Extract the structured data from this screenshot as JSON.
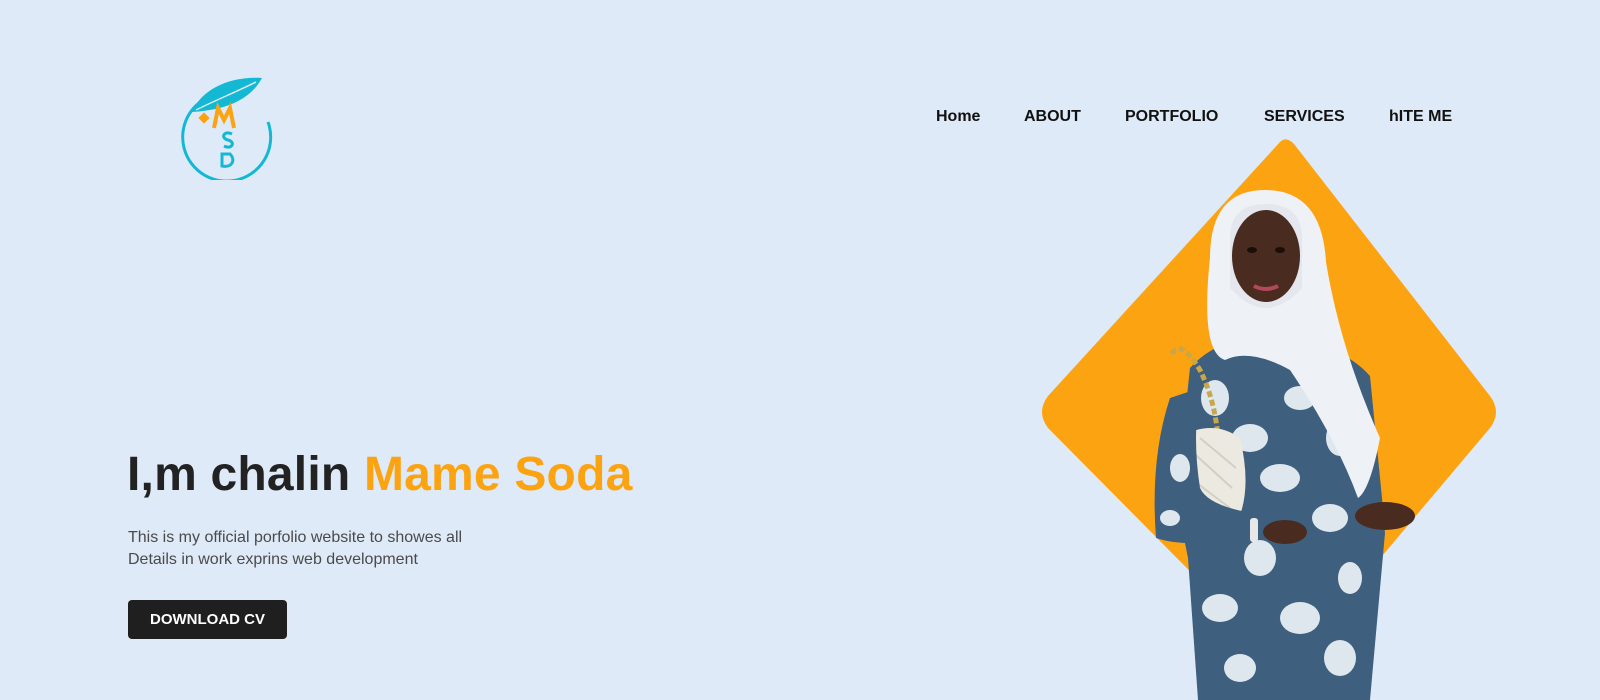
{
  "brand": {
    "logo_icon": "msd-leaf-logo-icon",
    "accent": "#fca311",
    "teal": "#13b8d3"
  },
  "nav": {
    "items": [
      {
        "label": "Home"
      },
      {
        "label": "ABOUT"
      },
      {
        "label": "PORTFOLIO"
      },
      {
        "label": "SERVICES"
      },
      {
        "label": "hITE ME"
      }
    ]
  },
  "hero": {
    "title_prefix": "I,m chalin ",
    "title_name": "Mame Soda",
    "description_line1": "This is my official porfolio website to showes all",
    "description_line2": "Details in work exprins web development",
    "cta_label": "DOWNLOAD CV"
  },
  "colors": {
    "background": "#dfeaf8",
    "button_bg": "#1f1f1f",
    "diamond": "#fca311"
  }
}
